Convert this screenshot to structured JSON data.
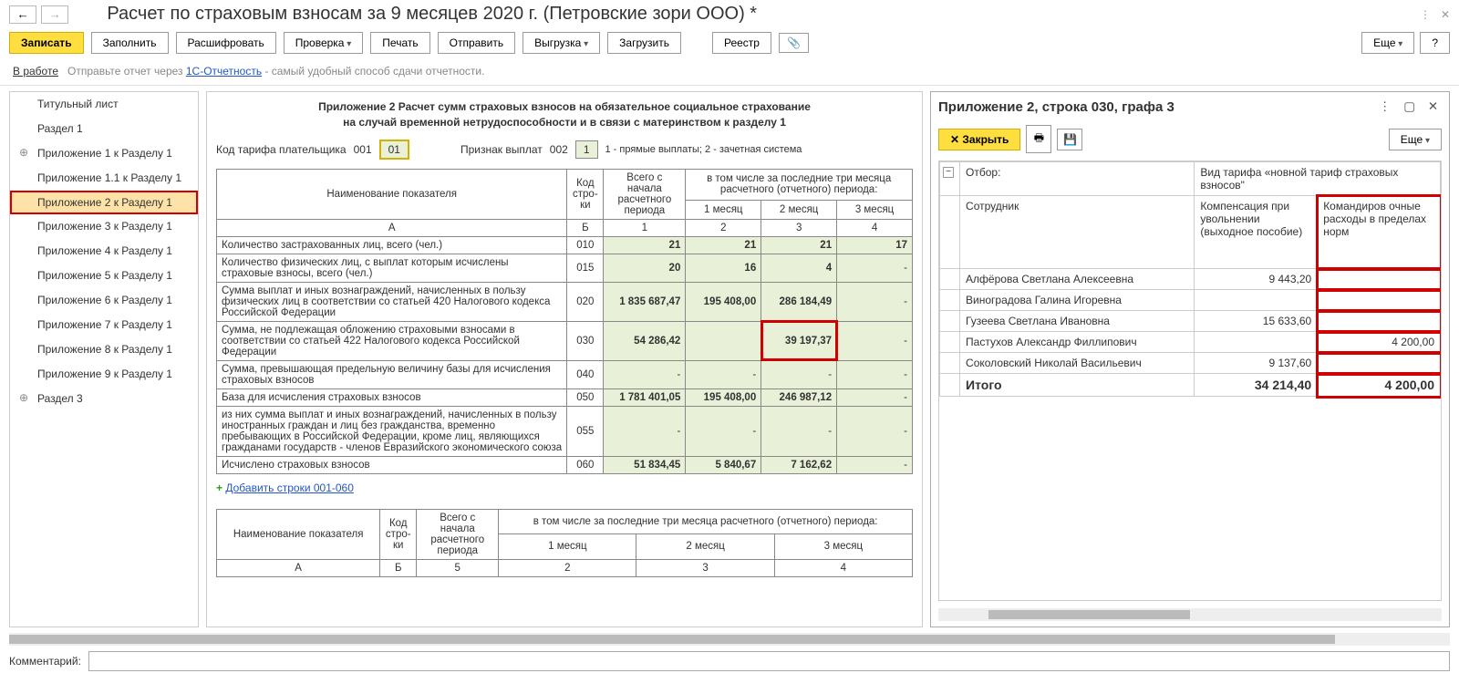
{
  "title": "Расчет по страховым взносам за 9 месяцев 2020 г. (Петровские зори ООО) *",
  "toolbar": {
    "back": "←",
    "fwd": "→",
    "save": "Записать",
    "fill": "Заполнить",
    "decode": "Расшифровать",
    "check": "Проверка",
    "print": "Печать",
    "send": "Отправить",
    "export": "Выгрузка",
    "load": "Загрузить",
    "registry": "Реестр",
    "attach": "📎",
    "more": "Еще",
    "help": "?"
  },
  "status": {
    "state": "В работе",
    "hint_pre": "Отправьте отчет через ",
    "hint_link": "1С-Отчетность",
    "hint_post": " - самый удобный способ сдачи отчетности."
  },
  "nav": [
    {
      "label": "Титульный лист"
    },
    {
      "label": "Раздел 1"
    },
    {
      "label": "Приложение 1 к Разделу 1",
      "exp": true
    },
    {
      "label": "Приложение 1.1 к Разделу 1"
    },
    {
      "label": "Приложение 2 к Разделу 1",
      "sel": true
    },
    {
      "label": "Приложение 3 к Разделу 1"
    },
    {
      "label": "Приложение 4 к Разделу 1"
    },
    {
      "label": "Приложение 5 к Разделу 1"
    },
    {
      "label": "Приложение 6 к Разделу 1"
    },
    {
      "label": "Приложение 7 к Разделу 1"
    },
    {
      "label": "Приложение 8 к Разделу 1"
    },
    {
      "label": "Приложение 9 к Разделу 1"
    },
    {
      "label": "Раздел 3",
      "exp": true
    }
  ],
  "form": {
    "heading_l1": "Приложение 2 Расчет сумм страховых взносов на обязательное социальное страхование",
    "heading_l2": "на случай временной нетрудоспособности и в связи с материнством к разделу 1",
    "p_tariff_lbl": "Код тарифа плательщика",
    "p_tariff_c": "001",
    "p_tariff_v": "01",
    "p_sign_lbl": "Признак выплат",
    "p_sign_c": "002",
    "p_sign_v": "1",
    "p_sign_note": "1 - прямые выплаты; 2 - зачетная система",
    "th_name": "Наименование показателя",
    "th_code": "Код стро-ки",
    "th_total": "Всего с начала расчетного периода",
    "th_last3": "в том числе за последние три месяца расчетного (отчетного) периода:",
    "th_m1": "1 месяц",
    "th_m2": "2 месяц",
    "th_m3": "3 месяц",
    "th_a": "А",
    "th_b": "Б",
    "th_1": "1",
    "th_2": "2",
    "th_3": "3",
    "th_4": "4",
    "rows": [
      {
        "name": "Количество застрахованных лиц, всего (чел.)",
        "code": "010",
        "v": [
          "21",
          "21",
          "21",
          "17"
        ]
      },
      {
        "name": "Количество физических лиц, с выплат которым исчислены страховые взносы, всего (чел.)",
        "code": "015",
        "v": [
          "20",
          "16",
          "4",
          "-"
        ]
      },
      {
        "name": "Сумма выплат и иных вознаграждений, начисленных в пользу физических лиц в соответствии со статьей 420 Налогового кодекса Российской Федерации",
        "code": "020",
        "v": [
          "1 835 687,47",
          "195 408,00",
          "286 184,49",
          "-"
        ]
      },
      {
        "name": "Сумма, не подлежащая обложению страховыми взносами в соответствии со статьей 422 Налогового кодекса Российской Федерации",
        "code": "030",
        "v": [
          "54 286,42",
          "",
          "39 197,37",
          "-"
        ],
        "hl_col": 2
      },
      {
        "name": "Сумма, превышающая предельную величину базы для исчисления страховых взносов",
        "code": "040",
        "v": [
          "-",
          "-",
          "-",
          "-"
        ]
      },
      {
        "name": "База для исчисления страховых взносов",
        "code": "050",
        "v": [
          "1 781 401,05",
          "195 408,00",
          "246 987,12",
          "-"
        ]
      },
      {
        "name": "из них сумма выплат и иных вознаграждений, начисленных в пользу иностранных граждан и лиц без гражданства, временно пребывающих в Российской Федерации, кроме лиц, являющихся гражданами государств - членов Евразийского экономического союза",
        "code": "055",
        "v": [
          "-",
          "-",
          "-",
          "-"
        ]
      },
      {
        "name": "Исчислено страховых взносов",
        "code": "060",
        "v": [
          "51 834,45",
          "5 840,67",
          "7 162,62",
          "-"
        ]
      }
    ],
    "addlink": "Добавить строки 001-060",
    "th_b5": "5"
  },
  "panel": {
    "title": "Приложение 2, строка 030, графа 3",
    "close": "Закрыть",
    "more": "Еще",
    "filter_lbl": "Отбор:",
    "filter_txt_pre": "Вид тарифа ",
    "filter_txt_val": "«новной тариф страховых взносов\"",
    "col_emp": "Сотрудник",
    "col_c1": "Компенсация при увольнении (выходное пособие)",
    "col_c2": "Командиров очные расходы в пределах норм",
    "rows": [
      {
        "n": "Алфёрова Светлана Алексеевна",
        "c1": "9 443,20",
        "c2": ""
      },
      {
        "n": "Виноградова Галина Игоревна",
        "c1": "",
        "c2": ""
      },
      {
        "n": "Гузеева Светлана Ивановна",
        "c1": "15 633,60",
        "c2": ""
      },
      {
        "n": "Пастухов Александр Филлипович",
        "c1": "",
        "c2": "4 200,00"
      },
      {
        "n": "Соколовский Николай Васильевич",
        "c1": "9 137,60",
        "c2": ""
      }
    ],
    "total_lbl": "Итого",
    "total_c1": "34 214,40",
    "total_c2": "4 200,00"
  },
  "footer": {
    "comment_lbl": "Комментарий:",
    "comment_val": ""
  }
}
